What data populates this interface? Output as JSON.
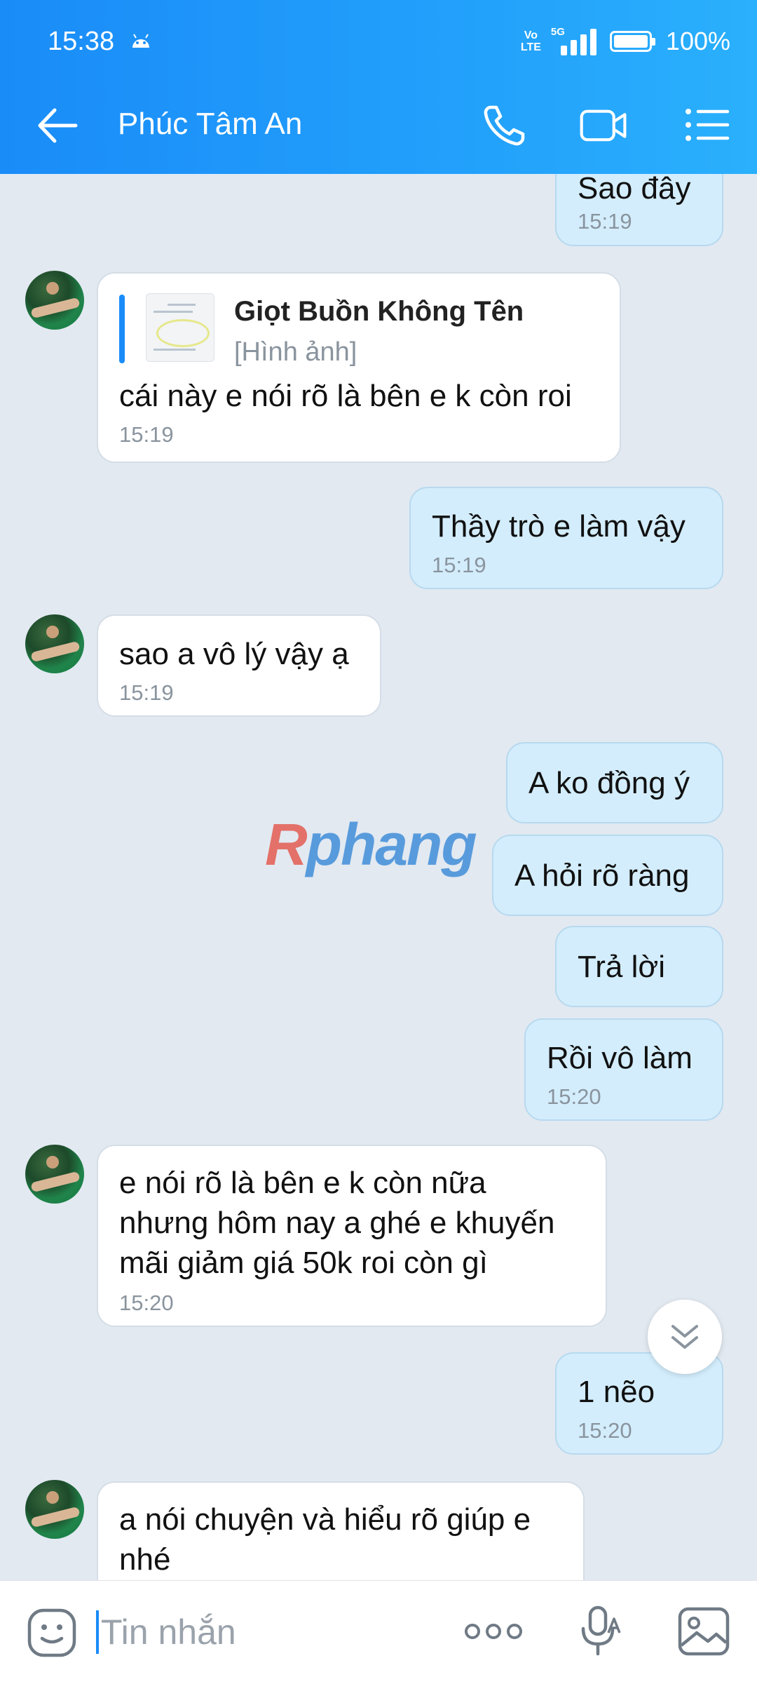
{
  "status_bar": {
    "time": "15:38",
    "network_top": "Vo",
    "network_bottom": "LTE",
    "signal_label": "5G",
    "battery": "100%"
  },
  "header": {
    "title": "Phúc Tâm An",
    "icons": [
      "back-arrow-icon",
      "phone-icon",
      "video-camera-icon",
      "menu-list-icon"
    ]
  },
  "messages": [
    {
      "side": "out",
      "text": "Sao đây",
      "time": "15:19"
    },
    {
      "side": "in",
      "quote": {
        "author": "Giọt Buồn Không Tên",
        "content": "[Hình ảnh]"
      },
      "text": "cái này e nói rõ là bên e k còn roi",
      "time": "15:19"
    },
    {
      "side": "out",
      "text": "Thầy trò e làm vậy",
      "time": "15:19"
    },
    {
      "side": "in",
      "text": "sao a vô lý vậy ạ",
      "time": "15:19"
    },
    {
      "side": "out",
      "text": "A ko đồng ý"
    },
    {
      "side": "out",
      "text": "A hỏi rõ ràng"
    },
    {
      "side": "out",
      "text": "Trả lời"
    },
    {
      "side": "out",
      "text": "Rồi vô làm",
      "time": "15:20"
    },
    {
      "side": "in",
      "text": "e nói rõ là bên e k còn nữa\nnhưng hôm nay a ghé e khuyến\nmãi giảm giá 50k roi còn gì",
      "time": "15:20"
    },
    {
      "side": "out",
      "text": "1 nẽo",
      "time": "15:20"
    },
    {
      "side": "in",
      "text": "a nói chuyện và hiểu rõ giúp e\nnhé"
    }
  ],
  "watermark": {
    "first": "R",
    "rest": "phang"
  },
  "input_bar": {
    "placeholder": "Tin nhắn",
    "icons": [
      "sticker-icon",
      "more-options-icon",
      "voice-icon",
      "image-icon"
    ]
  },
  "colors": {
    "header": "#1a8cf8",
    "outgoing_bubble": "#d3edfc",
    "incoming_bubble": "#ffffff",
    "background": "#e2e9f1",
    "accent": "#1a8cf8"
  }
}
